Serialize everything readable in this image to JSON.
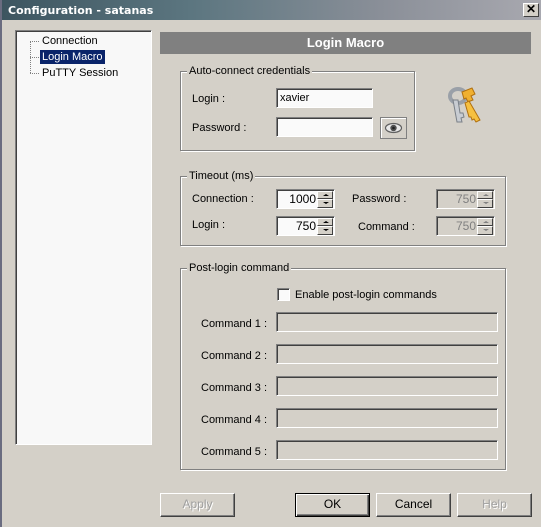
{
  "window": {
    "title": "Configuration - satanas",
    "close_symbol": "✕"
  },
  "tree": {
    "items": [
      {
        "label": "Connection",
        "selected": false
      },
      {
        "label": "Login Macro",
        "selected": true
      },
      {
        "label": "PuTTY Session",
        "selected": false
      }
    ]
  },
  "panel": {
    "title": "Login Macro"
  },
  "credentials": {
    "legend": "Auto-connect credentials",
    "login_label": "Login :",
    "login_value": "xavier",
    "password_label": "Password :",
    "password_value": "",
    "show_password_icon": "eye-icon",
    "decoration_icon": "keys-icon"
  },
  "timeout": {
    "legend": "Timeout (ms)",
    "connection_label": "Connection :",
    "connection_value": "1000",
    "login_label": "Login :",
    "login_value": "750",
    "password_label": "Password :",
    "password_value": "750",
    "command_label": "Command :",
    "command_value": "750"
  },
  "post_login": {
    "legend": "Post-login command",
    "enable_label": "Enable post-login commands",
    "enable_checked": false,
    "commands": [
      {
        "label": "Command 1 :",
        "value": ""
      },
      {
        "label": "Command 2 :",
        "value": ""
      },
      {
        "label": "Command 3 :",
        "value": ""
      },
      {
        "label": "Command 4 :",
        "value": ""
      },
      {
        "label": "Command 5 :",
        "value": ""
      }
    ]
  },
  "buttons": {
    "apply": "Apply",
    "ok": "OK",
    "cancel": "Cancel",
    "help": "Help"
  },
  "colors": {
    "selection": "#0a246a",
    "panel_header": "#808080",
    "dialog_bg": "#d4d0c8"
  }
}
